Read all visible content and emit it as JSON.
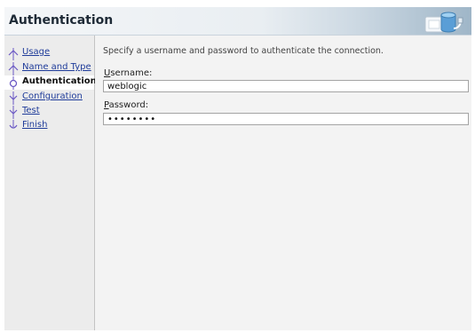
{
  "header": {
    "title": "Authentication",
    "graphic_icon": "database-connection-icon"
  },
  "sidebar": {
    "items": [
      {
        "label": "Usage",
        "state": "visited"
      },
      {
        "label": "Name and Type",
        "state": "visited"
      },
      {
        "label": "Authentication",
        "state": "current"
      },
      {
        "label": "Configuration",
        "state": "pending"
      },
      {
        "label": "Test",
        "state": "pending"
      },
      {
        "label": "Finish",
        "state": "pending"
      }
    ]
  },
  "main": {
    "description": "Specify a username and password to authenticate the connection.",
    "username_label_mnemonic": "U",
    "username_label_rest": "sername:",
    "username_value": "weblogic",
    "password_label_mnemonic": "P",
    "password_label_rest": "assword:",
    "password_value": "••••••••"
  },
  "colors": {
    "link": "#1f3c9a",
    "accent": "#6a58c4",
    "sidebar_bg": "#ececec",
    "content_bg": "#f3f3f3"
  }
}
